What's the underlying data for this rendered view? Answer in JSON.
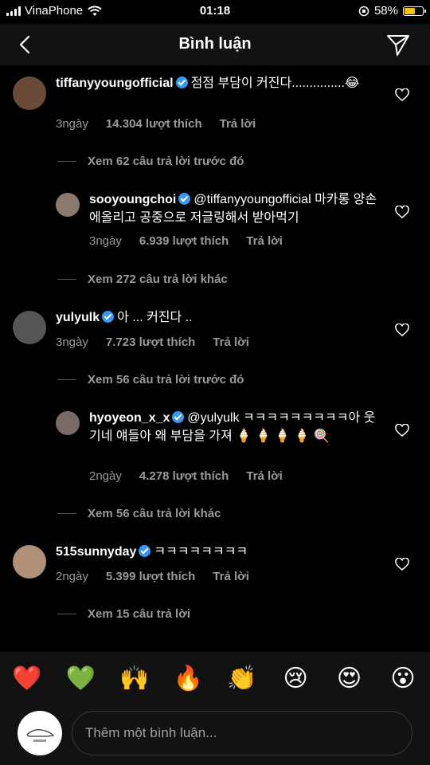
{
  "status_bar": {
    "carrier": "VinaPhone",
    "time": "01:18",
    "battery": "58%",
    "battery_level": 0.58
  },
  "header": {
    "title": "Bình luận"
  },
  "comments": [
    {
      "username": "tiffanyyoungofficial",
      "text": "점점 부담이 커진다...............😂",
      "time": "3ngày",
      "likes": "14.304 lượt thích",
      "reply": "Trả lời"
    },
    {
      "username": "sooyoungchoi",
      "text": "@tiffanyyoungofficial 마카롱 양손에올리고 공중으로 저글링해서 받아먹기",
      "time": "3ngày",
      "likes": "6.939 lượt thích",
      "reply": "Trả lời"
    },
    {
      "username": "yulyulk",
      "text": "아 ... 커진다 ..",
      "time": "3ngày",
      "likes": "7.723 lượt thích",
      "reply": "Trả lời"
    },
    {
      "username": "hyoyeon_x_x",
      "text": "@yulyulk ㅋㅋㅋㅋㅋㅋㅋㅋㅋ아 웃기네 얘들아 왜 부담을 가져 🍦 🍦 🍦 🍦 🍭",
      "time": "2ngày",
      "likes": "4.278 lượt thích",
      "reply": "Trả lời"
    },
    {
      "username": "515sunnyday",
      "text": "ㅋㅋㅋㅋㅋㅋㅋㅋ",
      "time": "2ngày",
      "likes": "5.399 lượt thích",
      "reply": "Trả lời"
    }
  ],
  "threads": [
    "Xem 62 câu trả lời trước đó",
    "Xem 272 câu trả lời khác",
    "Xem 56 câu trả lời trước đó",
    "Xem 56 câu trả lời khác",
    "Xem 15 câu trả lời"
  ],
  "emoji_bar": [
    "❤️",
    "💚",
    "🙌",
    "🔥",
    "👏",
    "😢",
    "😍",
    "😮"
  ],
  "input": {
    "placeholder": "Thêm một bình luận..."
  },
  "colors": {
    "background": "#000000",
    "header": "#121212",
    "muted": "#9a9a9a",
    "verified": "#3897f0",
    "battery": "#f5c400"
  }
}
